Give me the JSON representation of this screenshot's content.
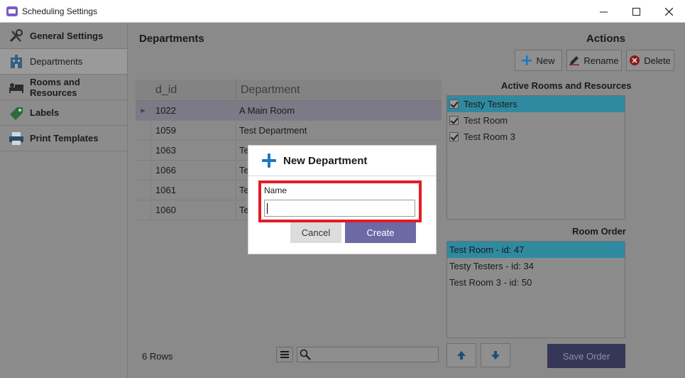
{
  "window": {
    "title": "Scheduling Settings",
    "controls": {
      "minimize": "–",
      "maximize": "☐",
      "close": "✕"
    }
  },
  "sidebar": {
    "items": [
      {
        "label": "General Settings",
        "icon": "tools-icon"
      },
      {
        "label": "Departments",
        "icon": "building-icon",
        "active": true
      },
      {
        "label": "Rooms and Resources",
        "icon": "bed-icon"
      },
      {
        "label": "Labels",
        "icon": "tag-icon"
      },
      {
        "label": "Print Templates",
        "icon": "printer-icon"
      }
    ]
  },
  "departments": {
    "title": "Departments",
    "columns": [
      "d_id",
      "Department"
    ],
    "rows": [
      {
        "id": "1022",
        "name": "A Main Room",
        "selected": true
      },
      {
        "id": "1059",
        "name": "Test Department"
      },
      {
        "id": "1063",
        "name": "Te"
      },
      {
        "id": "1066",
        "name": "Te"
      },
      {
        "id": "1061",
        "name": "Te"
      },
      {
        "id": "1060",
        "name": "Te"
      }
    ],
    "row_count": "6 Rows",
    "search_placeholder": ""
  },
  "actions": {
    "title": "Actions",
    "new_label": "New",
    "rename_label": "Rename",
    "delete_label": "Delete"
  },
  "active_rooms": {
    "title": "Active Rooms and Resources",
    "items": [
      {
        "label": "Testy Testers",
        "checked": true,
        "selected": true
      },
      {
        "label": "Test Room",
        "checked": true
      },
      {
        "label": "Test Room 3",
        "checked": true
      }
    ]
  },
  "room_order": {
    "title": "Room Order",
    "items": [
      {
        "label": "Test Room - id: 47",
        "selected": true
      },
      {
        "label": "Testy Testers - id: 34"
      },
      {
        "label": "Test Room 3 - id: 50"
      }
    ],
    "save_label": "Save Order"
  },
  "dialog": {
    "title": "New Department",
    "name_label": "Name",
    "name_value": "",
    "cancel_label": "Cancel",
    "create_label": "Create"
  },
  "colors": {
    "accent_blue": "#1b78c2",
    "selection_teal": "#2f8aa0",
    "create_button": "#6c6aa4",
    "highlight_red": "#e41b24"
  }
}
